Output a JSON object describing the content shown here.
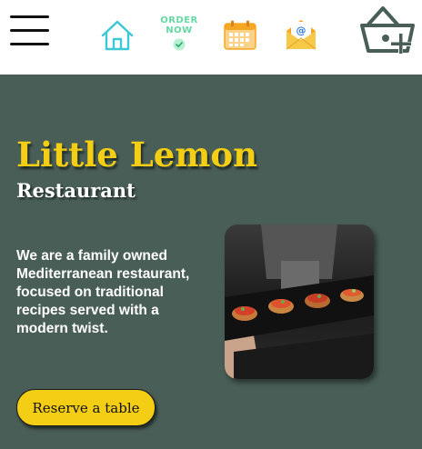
{
  "nav": {
    "menu_icon": "hamburger-menu-icon",
    "home_icon": "home-icon",
    "order": {
      "line1": "ORDER",
      "line2": "NOW",
      "icon": "order-now-icon"
    },
    "calendar_icon": "calendar-icon",
    "mail_icon": "mail-icon",
    "cart_icon": "cart-add-icon"
  },
  "hero": {
    "title": "Little Lemon",
    "subtitle": "Restaurant",
    "description": "We are a family owned Mediterranean restaurant, focused on traditional recipes served with a modern twist.",
    "image_icon": "bruschetta-photo",
    "cta_label": "Reserve a table"
  },
  "colors": {
    "primary_green": "#495e57",
    "accent_yellow": "#f4ce14",
    "white": "#ffffff",
    "home_icon_teal": "#3cc8d4",
    "order_green": "#66d9a3",
    "calendar_orange": "#f5a623",
    "mail_yellow": "#f7c948"
  }
}
